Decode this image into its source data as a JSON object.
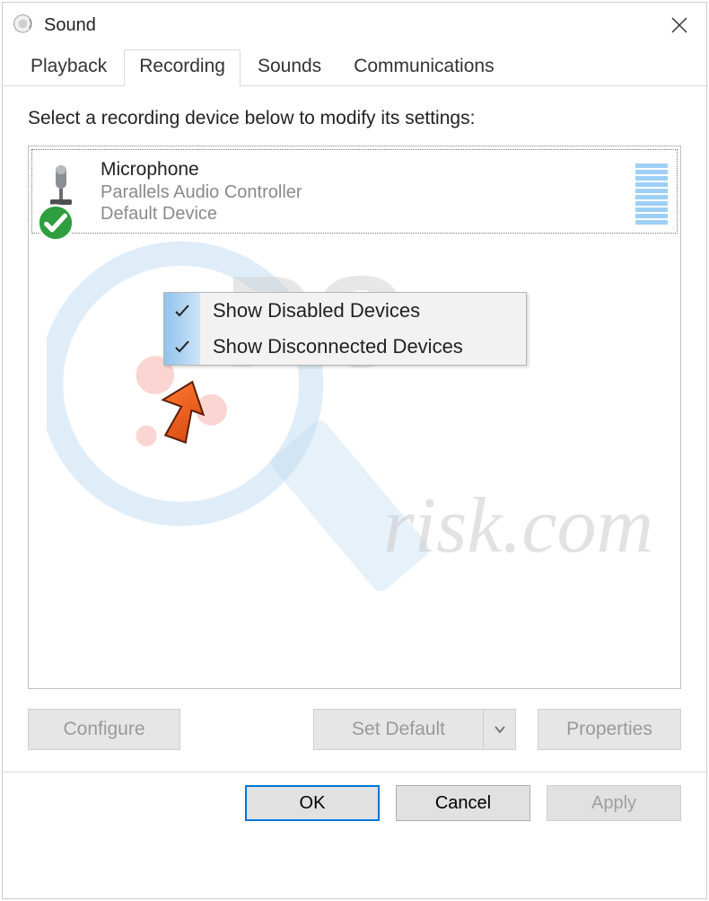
{
  "title": "Sound",
  "tabs": {
    "playback": "Playback",
    "recording": "Recording",
    "sounds": "Sounds",
    "communications": "Communications"
  },
  "active_tab": "recording",
  "instruction": "Select a recording device below to modify its settings:",
  "devices": [
    {
      "name": "Microphone",
      "description": "Parallels Audio Controller",
      "status": "Default Device",
      "checked": true
    }
  ],
  "context_menu": {
    "items": [
      {
        "label": "Show Disabled Devices",
        "checked": true
      },
      {
        "label": "Show Disconnected Devices",
        "checked": true
      }
    ]
  },
  "buttons": {
    "configure": "Configure",
    "set_default": "Set Default",
    "properties": "Properties",
    "ok": "OK",
    "cancel": "Cancel",
    "apply": "Apply"
  },
  "watermark_text": "risk.com",
  "icons": {
    "sound": "sound-icon",
    "close": "close-icon",
    "mic": "microphone-icon",
    "check": "checkmark-icon",
    "arrow": "pointer-arrow-icon",
    "chevron": "chevron-down-icon"
  }
}
